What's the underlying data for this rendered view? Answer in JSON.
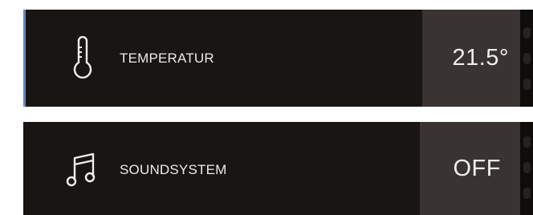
{
  "colors": {
    "panel_bg": "#181514",
    "value_bg": "#393433",
    "accent": "#6a86b9",
    "text": "#ecebea"
  },
  "rows": [
    {
      "icon": "thermometer-icon",
      "label": "TEMPERATUR",
      "value": "21.5°"
    },
    {
      "icon": "music-note-icon",
      "label": "SOUNDSYSTEM",
      "value": "OFF"
    }
  ]
}
